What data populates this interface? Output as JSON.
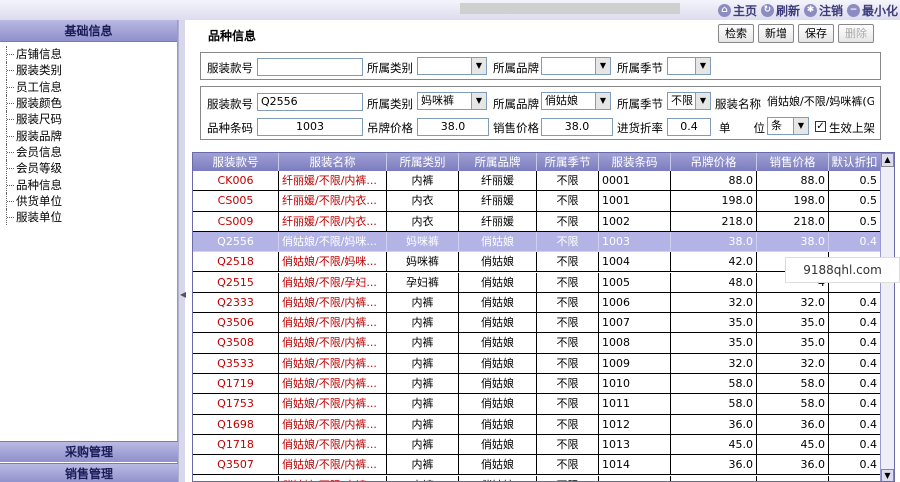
{
  "topbar": {
    "links": [
      {
        "label": "主页",
        "icon": "home-icon",
        "glyph": "⌂"
      },
      {
        "label": "刷新",
        "icon": "refresh-icon",
        "glyph": "↻"
      },
      {
        "label": "注销",
        "icon": "logout-icon",
        "glyph": "✱"
      },
      {
        "label": "最小化",
        "icon": "minimize-icon",
        "glyph": "−"
      }
    ]
  },
  "sidebar": {
    "title": "基础信息",
    "items": [
      "店铺信息",
      "服装类别",
      "员工信息",
      "服装颜色",
      "服装尺码",
      "服装品牌",
      "会员信息",
      "会员等级",
      "品种信息",
      "供货单位",
      "服装单位"
    ],
    "footers": [
      "采购管理",
      "销售管理"
    ]
  },
  "main": {
    "title": "品种信息",
    "toolbar": {
      "search": "检索",
      "add": "新增",
      "save": "保存",
      "delete": "删除"
    },
    "filter": {
      "code_label": "服装款号",
      "code_value": "",
      "category_label": "所属类别",
      "category_value": "",
      "brand_label": "所属品牌",
      "brand_value": "",
      "season_label": "所属季节",
      "season_value": ""
    },
    "detail": {
      "code_label": "服装款号",
      "code_value": "Q2556",
      "category_label": "所属类别",
      "category_value": "妈咪裤",
      "brand_label": "所属品牌",
      "brand_value": "俏姑娘",
      "season_label": "所属季节",
      "season_value": "不限",
      "name_label": "服装名称",
      "name_value": "俏姑娘/不限/妈咪裤(G",
      "barcode_label": "品种条码",
      "barcode_value": "1003",
      "tag_price_label": "吊牌价格",
      "tag_price_value": "38.0",
      "sale_price_label": "销售价格",
      "sale_price_value": "38.0",
      "discount_label": "进货折率",
      "discount_value": "0.4",
      "unit_label": "单　　位",
      "unit_value": "条",
      "active_label": "生效上架",
      "active_checked": "✓"
    }
  },
  "grid": {
    "columns": [
      "服装款号",
      "服装名称",
      "所属类别",
      "所属品牌",
      "所属季节",
      "服装条码",
      "吊牌价格",
      "销售价格",
      "默认折扣",
      "单"
    ],
    "rows": [
      [
        "CK006",
        "纤丽媛/不限/内裤...",
        "内裤",
        "纤丽媛",
        "不限",
        "0001",
        "88.0",
        "88.0",
        "0.5",
        "件"
      ],
      [
        "CS005",
        "纤丽媛/不限/内衣...",
        "内衣",
        "纤丽媛",
        "不限",
        "1001",
        "198.0",
        "198.0",
        "0.5",
        "件"
      ],
      [
        "CS009",
        "纤丽媛/不限/内衣...",
        "内衣",
        "纤丽媛",
        "不限",
        "1002",
        "218.0",
        "218.0",
        "0.5",
        "件"
      ],
      [
        "Q2556",
        "俏姑娘/不限/妈咪...",
        "妈咪裤",
        "俏姑娘",
        "不限",
        "1003",
        "38.0",
        "38.0",
        "0.4",
        "条"
      ],
      [
        "Q2518",
        "俏姑娘/不限/妈咪...",
        "妈咪裤",
        "俏姑娘",
        "不限",
        "1004",
        "42.0",
        "4",
        "",
        ""
      ],
      [
        "Q2515",
        "俏姑娘/不限/孕妇...",
        "孕妇裤",
        "俏姑娘",
        "不限",
        "1005",
        "48.0",
        "4",
        "",
        ""
      ],
      [
        "Q2333",
        "俏姑娘/不限/内裤...",
        "内裤",
        "俏姑娘",
        "不限",
        "1006",
        "32.0",
        "32.0",
        "0.4",
        "条"
      ],
      [
        "Q3506",
        "俏姑娘/不限/内裤...",
        "内裤",
        "俏姑娘",
        "不限",
        "1007",
        "35.0",
        "35.0",
        "0.4",
        "条"
      ],
      [
        "Q3508",
        "俏姑娘/不限/内裤...",
        "内裤",
        "俏姑娘",
        "不限",
        "1008",
        "35.0",
        "35.0",
        "0.4",
        "条"
      ],
      [
        "Q3533",
        "俏姑娘/不限/内裤...",
        "内裤",
        "俏姑娘",
        "不限",
        "1009",
        "32.0",
        "32.0",
        "0.4",
        "条"
      ],
      [
        "Q1719",
        "俏姑娘/不限/内裤...",
        "内裤",
        "俏姑娘",
        "不限",
        "1010",
        "58.0",
        "58.0",
        "0.4",
        "条"
      ],
      [
        "Q1753",
        "俏姑娘/不限/内裤...",
        "内裤",
        "俏姑娘",
        "不限",
        "1011",
        "58.0",
        "58.0",
        "0.4",
        "条"
      ],
      [
        "Q1698",
        "俏姑娘/不限/内裤...",
        "内裤",
        "俏姑娘",
        "不限",
        "1012",
        "36.0",
        "36.0",
        "0.4",
        "条"
      ],
      [
        "Q1718",
        "俏姑娘/不限/内裤...",
        "内裤",
        "俏姑娘",
        "不限",
        "1013",
        "45.0",
        "45.0",
        "0.4",
        "条"
      ],
      [
        "Q3507",
        "俏姑娘/不限/内裤...",
        "内裤",
        "俏姑娘",
        "不限",
        "1014",
        "36.0",
        "36.0",
        "0.4",
        "条"
      ],
      [
        "Q3510",
        "俏姑娘/不限/内裤...",
        "内裤",
        "俏姑娘",
        "不限",
        "1015",
        "",
        "",
        "",
        ""
      ]
    ],
    "selected_index": 3
  },
  "watermark": "9188qhl.com"
}
